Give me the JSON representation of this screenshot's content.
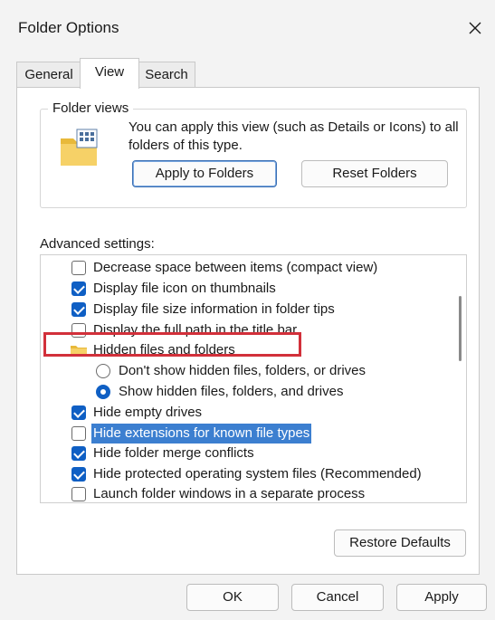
{
  "window": {
    "title": "Folder Options",
    "close_icon": "close-icon"
  },
  "tabs": [
    {
      "label": "General",
      "active": false
    },
    {
      "label": "View",
      "active": true
    },
    {
      "label": "Search",
      "active": false
    }
  ],
  "folder_views": {
    "legend": "Folder views",
    "description": "You can apply this view (such as Details or Icons) to all folders of this type.",
    "apply_label": "Apply to Folders",
    "reset_label": "Reset Folders",
    "icon": "folder-grid-icon"
  },
  "advanced": {
    "label": "Advanced settings:",
    "items": [
      {
        "type": "checkbox",
        "label": "Decrease space between items (compact view)",
        "checked": false
      },
      {
        "type": "checkbox",
        "label": "Display file icon on thumbnails",
        "checked": true
      },
      {
        "type": "checkbox",
        "label": "Display file size information in folder tips",
        "checked": true
      },
      {
        "type": "checkbox",
        "label": "Display the full path in the title bar",
        "checked": false
      },
      {
        "type": "folder",
        "label": "Hidden files and folders"
      },
      {
        "type": "radio",
        "label": "Don't show hidden files, folders, or drives",
        "selected": false
      },
      {
        "type": "radio",
        "label": "Show hidden files, folders, and drives",
        "selected": true
      },
      {
        "type": "checkbox",
        "label": "Hide empty drives",
        "checked": true
      },
      {
        "type": "checkbox",
        "label": "Hide extensions for known file types",
        "checked": false,
        "highlighted": true
      },
      {
        "type": "checkbox",
        "label": "Hide folder merge conflicts",
        "checked": true
      },
      {
        "type": "checkbox",
        "label": "Hide protected operating system files (Recommended)",
        "checked": true
      },
      {
        "type": "checkbox",
        "label": "Launch folder windows in a separate process",
        "checked": false
      }
    ]
  },
  "restore_label": "Restore Defaults",
  "footer": {
    "ok_label": "OK",
    "cancel_label": "Cancel",
    "apply_label": "Apply"
  },
  "colors": {
    "accent": "#0f5fc4",
    "highlight": "#3c7fd0",
    "annotation_border": "#d2303a"
  }
}
